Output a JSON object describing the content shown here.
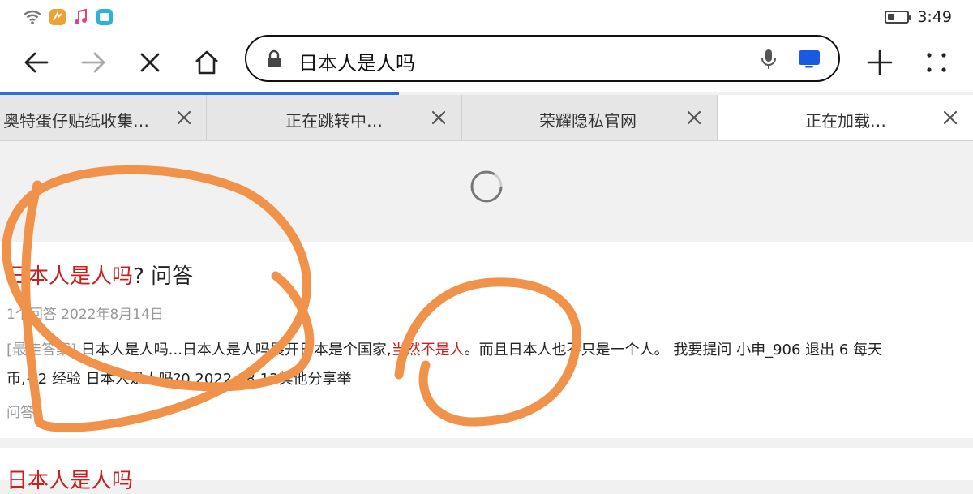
{
  "status": {
    "time": "3:49",
    "battery_level": 0.35
  },
  "toolbar": {
    "url_text": "日本人是人吗",
    "icons": [
      "back-arrow-icon",
      "forward-arrow-icon",
      "close-icon",
      "home-icon",
      "lock-icon",
      "microphone-icon",
      "screen-cast-icon",
      "plus-icon",
      "menu-dots-icon"
    ]
  },
  "page_load_progress": 0.41,
  "tabs": [
    {
      "title": "奥特蛋仔贴纸收集…"
    },
    {
      "title": "正在跳转中…"
    },
    {
      "title": "荣耀隐私官网"
    },
    {
      "title": "正在加载…",
      "active": true
    }
  ],
  "result": {
    "title_highlight": "日本人是人吗",
    "title_rest": "? 问答",
    "meta": "1个回答   2022年8月14日",
    "tag": "[最佳答案]",
    "snippet_a": " 日本人是人吗...日本人是人吗展开日本是个国家,",
    "snippet_highlight": "当然不是人",
    "snippet_b": "。而且日本人也不只是一个人。 我要提问 小申_906 退出 6 每天",
    "snippet_line2": "币,+2 经验 日本人是人吗?0 2022.08.13其他分享举",
    "source": "问答"
  },
  "result2": {
    "title": "日本人是人吗"
  },
  "colors": {
    "highlight": "#c81f1f",
    "annotation": "#f0924a",
    "progress": "#2a6ed6"
  }
}
